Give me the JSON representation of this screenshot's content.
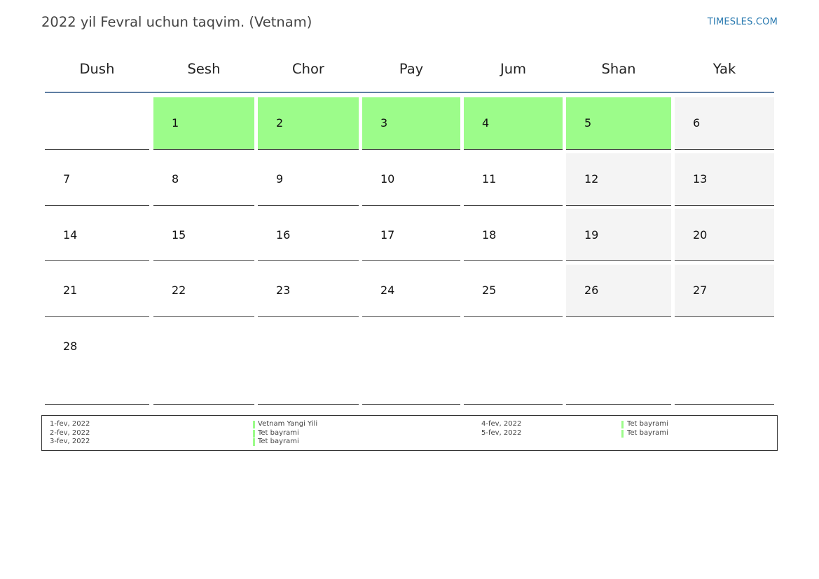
{
  "title": "2022 yil Fevral uchun taqvim. (Vetnam)",
  "site": "TIMESLES.COM",
  "colors": {
    "holiday": "#9cfc8a",
    "weekend": "#f4f4f4",
    "header_rule": "#5f7ea3",
    "link": "#2a7ab0"
  },
  "weekdays": [
    "Dush",
    "Sesh",
    "Chor",
    "Pay",
    "Jum",
    "Shan",
    "Yak"
  ],
  "weeks": [
    [
      null,
      {
        "day": "1",
        "type": "holiday"
      },
      {
        "day": "2",
        "type": "holiday"
      },
      {
        "day": "3",
        "type": "holiday"
      },
      {
        "day": "4",
        "type": "holiday"
      },
      {
        "day": "5",
        "type": "holiday"
      },
      {
        "day": "6",
        "type": "weekend"
      }
    ],
    [
      {
        "day": "7"
      },
      {
        "day": "8"
      },
      {
        "day": "9"
      },
      {
        "day": "10"
      },
      {
        "day": "11"
      },
      {
        "day": "12",
        "type": "weekend"
      },
      {
        "day": "13",
        "type": "weekend"
      }
    ],
    [
      {
        "day": "14"
      },
      {
        "day": "15"
      },
      {
        "day": "16"
      },
      {
        "day": "17"
      },
      {
        "day": "18"
      },
      {
        "day": "19",
        "type": "weekend"
      },
      {
        "day": "20",
        "type": "weekend"
      }
    ],
    [
      {
        "day": "21"
      },
      {
        "day": "22"
      },
      {
        "day": "23"
      },
      {
        "day": "24"
      },
      {
        "day": "25"
      },
      {
        "day": "26",
        "type": "weekend"
      },
      {
        "day": "27",
        "type": "weekend"
      }
    ],
    [
      {
        "day": "28"
      },
      null,
      null,
      null,
      null,
      null,
      null
    ]
  ],
  "legend": [
    {
      "date": "1-fev, 2022",
      "name": "Vetnam Yangi Yili"
    },
    {
      "date": "2-fev, 2022",
      "name": "Tet bayrami"
    },
    {
      "date": "3-fev, 2022",
      "name": "Tet bayrami"
    },
    {
      "date": "4-fev, 2022",
      "name": "Tet bayrami"
    },
    {
      "date": "5-fev, 2022",
      "name": "Tet bayrami"
    }
  ]
}
